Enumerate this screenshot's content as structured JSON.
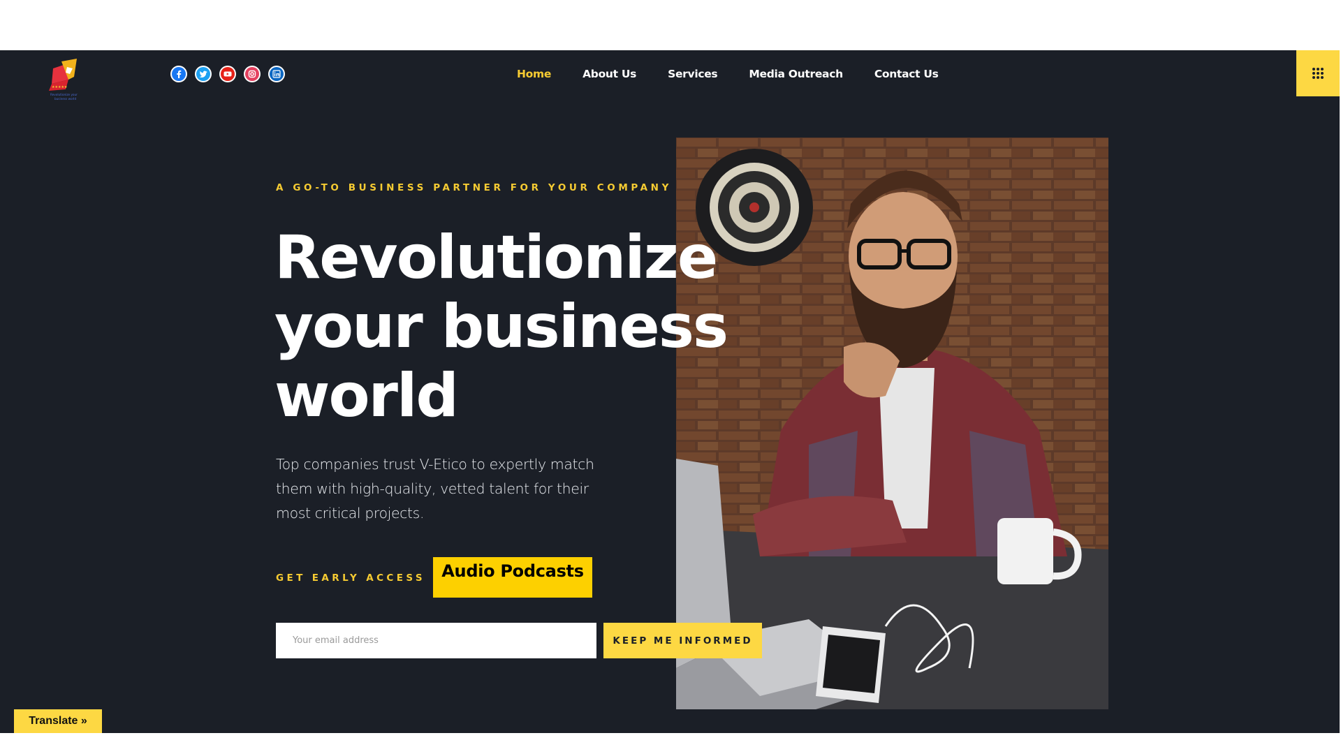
{
  "header": {
    "logo_icon": "v-etico-logo",
    "logo_tagline": "Revolutionize your business world",
    "social": [
      {
        "name": "facebook-icon",
        "color": "#1877f2"
      },
      {
        "name": "twitter-icon",
        "color": "#1da1f2"
      },
      {
        "name": "youtube-icon",
        "color": "#ff0000"
      },
      {
        "name": "instagram-icon",
        "color": "#e4405f"
      },
      {
        "name": "linkedin-icon",
        "color": "#0a66c2"
      }
    ],
    "nav": [
      {
        "label": "Home",
        "active": true
      },
      {
        "label": "About Us",
        "active": false
      },
      {
        "label": "Services",
        "active": false
      },
      {
        "label": "Media Outreach",
        "active": false
      },
      {
        "label": "Contact Us",
        "active": false
      }
    ],
    "menu_icon": "grid-menu-icon"
  },
  "hero": {
    "eyebrow": "A GO-TO BUSINESS PARTNER FOR YOUR COMPANY",
    "headline": [
      "Revolutionize",
      "your business",
      "world"
    ],
    "description": "Top companies trust V-Etico to expertly match them with high-quality, vetted talent for their most critical projects.",
    "early_access": "GET EARLY ACCESS",
    "podcasts_button": "Audio Podcasts",
    "email_placeholder": "Your email address",
    "submit_button": "KEEP ME INFORMED",
    "photo": "bearded-man-with-laptop-photo"
  },
  "translate_button": "Translate »",
  "colors": {
    "background": "#1b1f27",
    "accent": "#f6cb32",
    "button": "#fdd843",
    "podcast_button": "#fdd000",
    "text": "#ffffff"
  }
}
